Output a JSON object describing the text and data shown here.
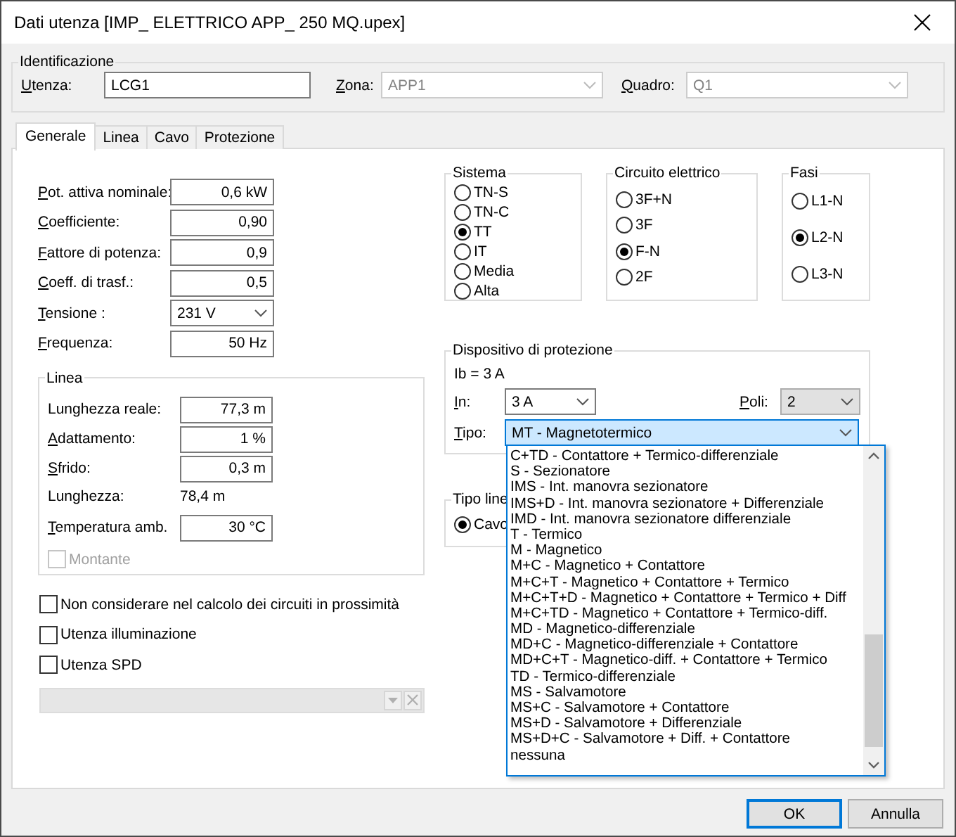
{
  "window": {
    "title": "Dati utenza [IMP_ ELETTRICO APP_ 250 MQ.upex]"
  },
  "identification": {
    "title": "Identificazione",
    "fields": [
      {
        "kind": "text",
        "label": "Utenza:",
        "accel": true,
        "value": "LCG1",
        "disabled": false
      },
      {
        "kind": "combo",
        "label": "Zona:",
        "accel": true,
        "value": "APP1",
        "disabled": true
      },
      {
        "kind": "combo",
        "label": "Quadro:",
        "accel": true,
        "value": "Q1",
        "disabled": true
      }
    ]
  },
  "tabs": [
    {
      "label": "Generale",
      "selected": true
    },
    {
      "label": "Linea",
      "selected": false
    },
    {
      "label": "Cavo",
      "selected": false
    },
    {
      "label": "Protezione",
      "selected": false
    }
  ],
  "general_fields": [
    {
      "kind": "text",
      "label": "Pot. attiva nominale:",
      "accel": true,
      "value": "0,6 kW"
    },
    {
      "kind": "text",
      "label": "Coefficiente:",
      "accel": true,
      "value": "0,90"
    },
    {
      "kind": "text",
      "label": "Fattore di potenza:",
      "accel": true,
      "value": "0,9"
    },
    {
      "kind": "text",
      "label": "Coeff. di trasf.:",
      "accel": true,
      "value": "0,5"
    },
    {
      "kind": "combo",
      "label": "Tensione :",
      "accel": true,
      "value": "231 V"
    },
    {
      "kind": "text",
      "label": "Frequenza:",
      "accel": true,
      "value": "50 Hz"
    }
  ],
  "linea": {
    "title": "Linea",
    "fields": [
      {
        "kind": "text",
        "label": "Lunghezza reale:",
        "accel": false,
        "value": "77,3 m"
      },
      {
        "kind": "text",
        "label": "Adattamento:",
        "accel": true,
        "value": "1 %"
      },
      {
        "kind": "text",
        "label": "Sfrido:",
        "accel": true,
        "value": "0,3 m"
      },
      {
        "kind": "readout",
        "label": "Lunghezza:",
        "accel": false,
        "value": "78,4 m"
      },
      {
        "kind": "text",
        "label": "Temperatura amb.",
        "accel": true,
        "value": "30 °C"
      }
    ],
    "montante": {
      "label": "Montante",
      "checked": false,
      "disabled": true
    }
  },
  "checkboxes": [
    {
      "label": "Non considerare nel calcolo dei circuiti in prossimità",
      "checked": false
    },
    {
      "label": "Utenza illuminazione",
      "checked": false
    },
    {
      "label": "Utenza SPD",
      "checked": false
    }
  ],
  "spd_selector": {
    "disabled": true
  },
  "radio_groups": [
    {
      "title": "Sistema",
      "options": [
        {
          "label": "TN-S",
          "selected": false
        },
        {
          "label": "TN-C",
          "selected": false
        },
        {
          "label": "TT",
          "selected": true
        },
        {
          "label": "IT",
          "selected": false
        },
        {
          "label": "Media",
          "selected": false
        },
        {
          "label": "Alta",
          "selected": false
        }
      ]
    },
    {
      "title": "Circuito elettrico",
      "options": [
        {
          "label": "3F+N",
          "selected": false
        },
        {
          "label": "3F",
          "selected": false
        },
        {
          "label": "F-N",
          "selected": true
        },
        {
          "label": "2F",
          "selected": false
        }
      ]
    },
    {
      "title": "Fasi",
      "options": [
        {
          "label": "L1-N",
          "selected": false
        },
        {
          "label": "L2-N",
          "selected": true
        },
        {
          "label": "L3-N",
          "selected": false
        }
      ]
    }
  ],
  "protezione": {
    "title": "Dispositivo di protezione",
    "ib": "Ib = 3 A",
    "in": {
      "kind": "combo",
      "label": "In:",
      "accel": true,
      "value": "3 A"
    },
    "poli": {
      "kind": "droplist",
      "label": "Poli:",
      "accel": true,
      "value": "2"
    },
    "tipo": {
      "kind": "combo",
      "label": "Tipo:",
      "accel": true,
      "value": "MT - Magnetotermico",
      "expanded": true,
      "options": [
        {
          "label": "C+TD - Contattore + Termico-differenziale",
          "selected": false
        },
        {
          "label": "S - Sezionatore",
          "selected": false
        },
        {
          "label": "IMS - Int. manovra sezionatore",
          "selected": false
        },
        {
          "label": "IMS+D - Int. manovra sezionatore + Differenziale",
          "selected": false
        },
        {
          "label": "IMD - Int. manovra sezionatore differenziale",
          "selected": false
        },
        {
          "label": "T - Termico",
          "selected": false
        },
        {
          "label": "M - Magnetico",
          "selected": false
        },
        {
          "label": "M+C - Magnetico + Contattore",
          "selected": false
        },
        {
          "label": "M+C+T - Magnetico + Contattore + Termico",
          "selected": false
        },
        {
          "label": "M+C+T+D - Magnetico + Contattore + Termico + Diff",
          "selected": false
        },
        {
          "label": "M+C+TD - Magnetico + Contattore + Termico-diff.",
          "selected": false
        },
        {
          "label": "MD - Magnetico-differenziale",
          "selected": false
        },
        {
          "label": "MD+C - Magnetico-differenziale + Contattore",
          "selected": false
        },
        {
          "label": "MD+C+T - Magnetico-diff. + Contattore + Termico",
          "selected": false
        },
        {
          "label": "TD - Termico-differenziale",
          "selected": false
        },
        {
          "label": "MS - Salvamotore",
          "selected": false
        },
        {
          "label": "MS+C - Salvamotore + Contattore",
          "selected": false
        },
        {
          "label": "MS+D - Salvamotore + Differenziale",
          "selected": false
        },
        {
          "label": "MS+D+C - Salvamotore + Diff. + Contattore",
          "selected": false
        },
        {
          "label": "nessuna",
          "selected": false
        }
      ]
    }
  },
  "tipo_linea": {
    "title": "Tipo line",
    "options": [
      {
        "label": "Cavo",
        "selected": true
      }
    ]
  },
  "buttons": [
    {
      "label": "OK",
      "default": true
    },
    {
      "label": "Annulla",
      "default": false
    }
  ]
}
